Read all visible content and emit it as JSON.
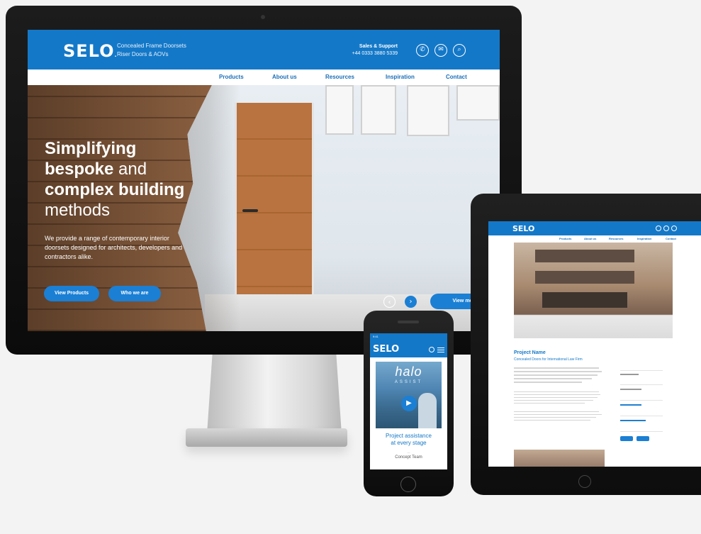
{
  "desktop": {
    "logo": "SELO",
    "logo_mark": ".",
    "tagline_line1": "Concealed Frame Doorsets",
    "tagline_line2": "Riser Doors & AOVs",
    "support_label": "Sales & Support",
    "support_phone": "+44 0333 3880 5339",
    "header_icons": [
      "phone-icon",
      "mail-icon",
      "search-icon"
    ],
    "nav": [
      "Products",
      "About us",
      "Resources",
      "Inspiration",
      "Contact"
    ],
    "hero_title_line1": "Simplifying",
    "hero_title_line2_bold": "bespoke",
    "hero_title_line2_rest": " and",
    "hero_title_line3": "complex building",
    "hero_title_line4": "methods",
    "hero_text": "We provide a range of contemporary interior doorsets designed for architects, developers and contractors alike.",
    "btn_products": "View Products",
    "btn_who": "Who we are",
    "btn_view_more": "View more",
    "arrow_prev": "‹",
    "arrow_next": "›",
    "apple": "",
    "accent": "#1478c8"
  },
  "tablet": {
    "logo": "SELO",
    "project_title": "Project Name",
    "project_sub": "Concealed Doors for International Law Firm",
    "nav": [
      "Products",
      "About us",
      "Resources",
      "Inspiration",
      "Contact"
    ]
  },
  "phone": {
    "time": "9:41",
    "logo": "SELO",
    "halo": "halo",
    "assist": "ASSIST",
    "play": "▶",
    "project_line1": "Project assistance",
    "project_line2": "at every stage",
    "team": "Concept Team"
  }
}
